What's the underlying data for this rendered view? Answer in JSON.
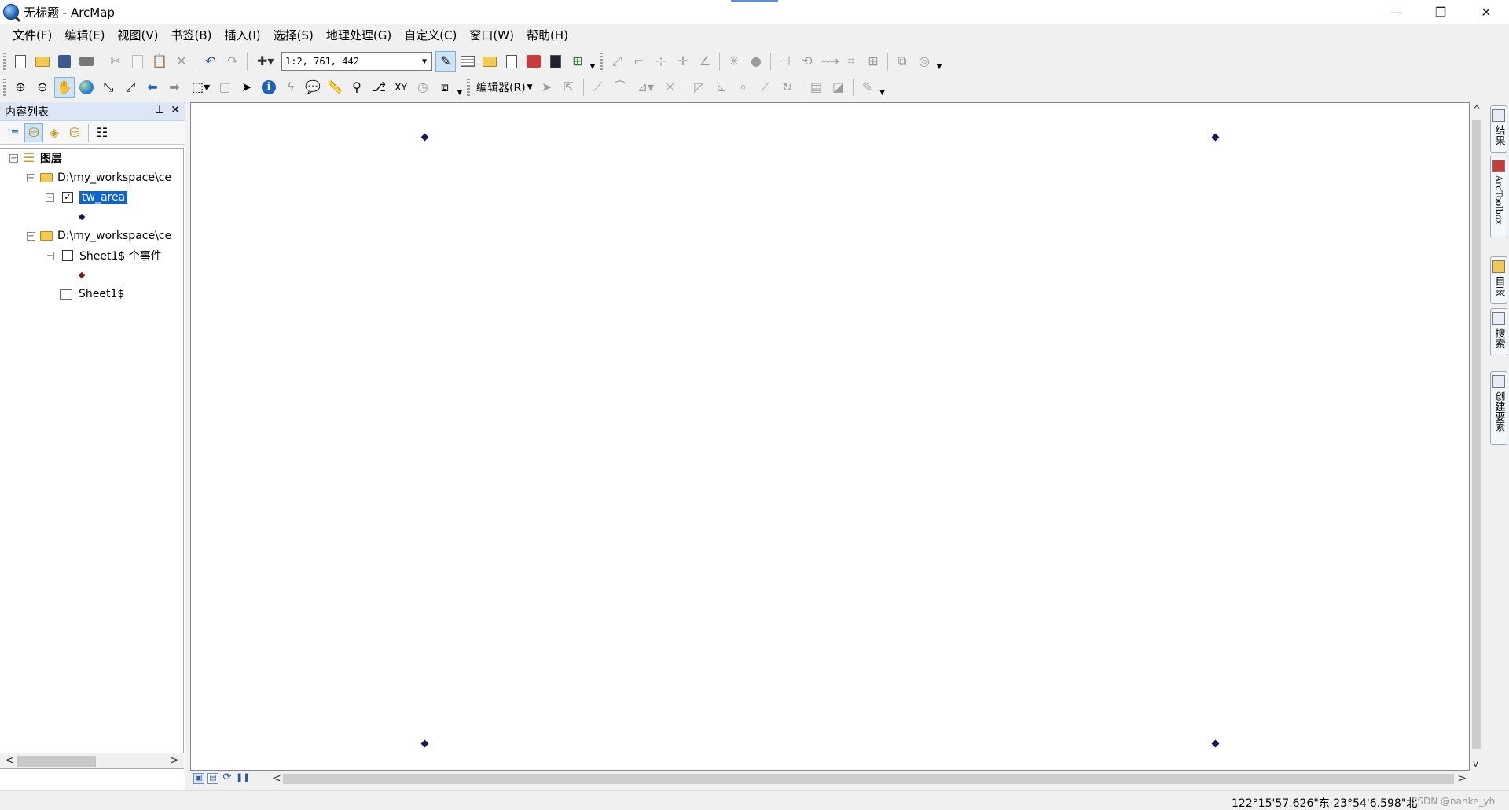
{
  "window": {
    "title": "无标题 - ArcMap",
    "controls": [
      "—",
      "❐",
      "✕"
    ]
  },
  "menu": [
    "文件(F)",
    "编辑(E)",
    "视图(V)",
    "书签(B)",
    "插入(I)",
    "选择(S)",
    "地理处理(G)",
    "自定义(C)",
    "窗口(W)",
    "帮助(H)"
  ],
  "toolbar": {
    "scale_value": "1:2, 761, 442",
    "editor_label": "编辑器(R)"
  },
  "toc": {
    "title": "内容列表",
    "pin": "⊥",
    "close": "✕",
    "root_label": "图层",
    "items": [
      {
        "label": "D:\\my_workspace\\ce"
      },
      {
        "label": "tw_area",
        "checked": true,
        "selected": true
      },
      {
        "label": "D:\\my_workspace\\ce"
      },
      {
        "label": "Sheet1$ 个事件",
        "checked": false
      },
      {
        "label": "Sheet1$"
      }
    ],
    "expander_symbol": "−",
    "check_symbol": "✓",
    "scroll_left": "<",
    "scroll_right": ">"
  },
  "map": {
    "point_color": "#131859",
    "scroll_up": "^",
    "scroll_down": "v",
    "scroll_left": "<",
    "scroll_right": ">"
  },
  "right_dock": [
    {
      "label": "结果",
      "icon": "results-icon"
    },
    {
      "label": "ArcToolbox",
      "icon": "toolbox-icon"
    },
    {
      "label": "目录",
      "icon": "catalog-icon"
    },
    {
      "label": "搜索",
      "icon": "search-icon"
    },
    {
      "label": "创建要素",
      "icon": "create-features-icon"
    }
  ],
  "status": {
    "coordinates": "122°15'57.626\"东  23°54'6.598\"北",
    "watermark": "CSDN @nanke_yh"
  },
  "colors": {
    "selection": "#0a64d8",
    "toc_header": "#dce6f4"
  }
}
